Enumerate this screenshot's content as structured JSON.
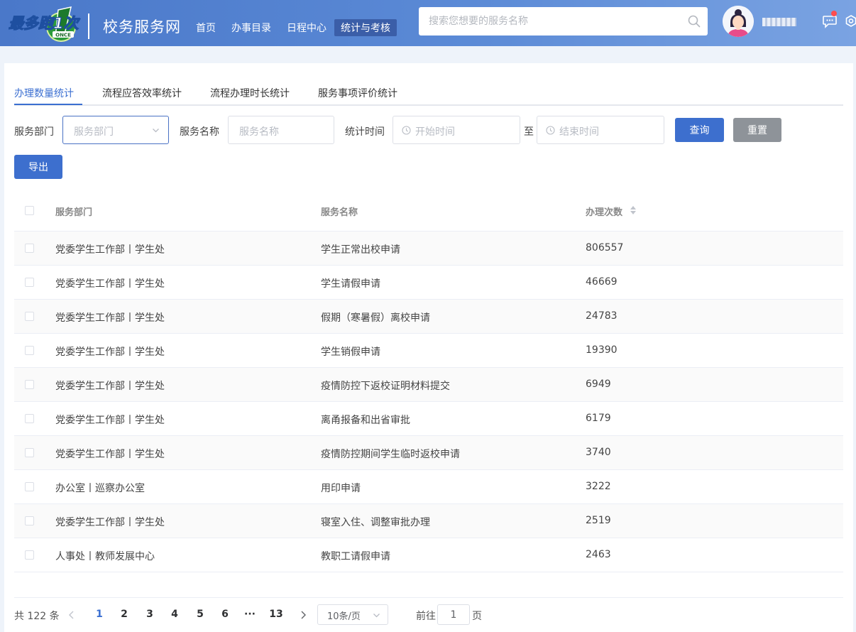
{
  "header": {
    "logo_text": "最多跑1次",
    "logo_sub": "ONCE",
    "site_title": "校务服务网",
    "nav": [
      "首页",
      "办事目录",
      "日程中心",
      "统计与考核"
    ],
    "search_placeholder": "搜索您想要的服务名称",
    "notification_dot_color": "#ff4d4f",
    "accent_color": "#3d6fce"
  },
  "tabs": [
    "办理数量统计",
    "流程应答效率统计",
    "流程办理时长统计",
    "服务事项评价统计"
  ],
  "filters": {
    "dept_label": "服务部门",
    "dept_placeholder": "服务部门",
    "name_label": "服务名称",
    "name_placeholder": "服务名称",
    "time_label": "统计时间",
    "start_placeholder": "开始时间",
    "to_label": "至",
    "end_placeholder": "结束时间",
    "query_button": "查询",
    "reset_button": "重置",
    "export_button": "导出"
  },
  "table": {
    "columns": [
      "服务部门",
      "服务名称",
      "办理次数"
    ],
    "rows": [
      {
        "dept": "党委学生工作部丨学生处",
        "name": "学生正常出校申请",
        "count": "806557"
      },
      {
        "dept": "党委学生工作部丨学生处",
        "name": "学生请假申请",
        "count": "46669"
      },
      {
        "dept": "党委学生工作部丨学生处",
        "name": "假期（寒暑假）离校申请",
        "count": "24783"
      },
      {
        "dept": "党委学生工作部丨学生处",
        "name": "学生销假申请",
        "count": "19390"
      },
      {
        "dept": "党委学生工作部丨学生处",
        "name": "疫情防控下返校证明材料提交",
        "count": "6949"
      },
      {
        "dept": "党委学生工作部丨学生处",
        "name": "离甬报备和出省审批",
        "count": "6179"
      },
      {
        "dept": "党委学生工作部丨学生处",
        "name": "疫情防控期间学生临时返校申请",
        "count": "3740"
      },
      {
        "dept": "办公室丨巡察办公室",
        "name": "用印申请",
        "count": "3222"
      },
      {
        "dept": "党委学生工作部丨学生处",
        "name": "寝室入住、调整审批办理",
        "count": "2519"
      },
      {
        "dept": "人事处丨教师发展中心",
        "name": "教职工请假申请",
        "count": "2463"
      }
    ]
  },
  "pagination": {
    "total": "共 122 条",
    "pages": [
      "1",
      "2",
      "3",
      "4",
      "5",
      "6",
      "···",
      "13"
    ],
    "current_page": "1",
    "page_size": "10条/页",
    "goto_label": "前往",
    "goto_value": "1",
    "page_suffix": "页"
  }
}
